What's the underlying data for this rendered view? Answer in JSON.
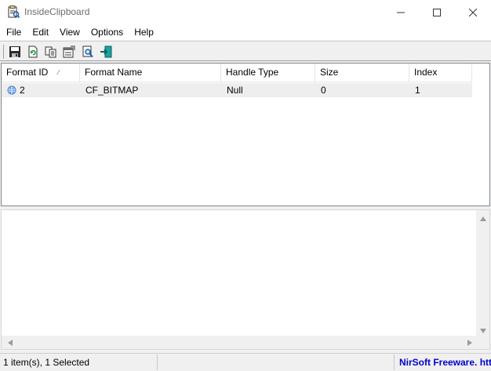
{
  "window": {
    "title": "InsideClipboard"
  },
  "menu": [
    "File",
    "Edit",
    "View",
    "Options",
    "Help"
  ],
  "toolbar": [
    {
      "name": "save-icon"
    },
    {
      "name": "refresh-icon"
    },
    {
      "name": "copy-icon"
    },
    {
      "name": "properties-icon"
    },
    {
      "name": "find-icon"
    },
    {
      "name": "exit-icon"
    }
  ],
  "table": {
    "columns": [
      "Format ID",
      "Format Name",
      "Handle Type",
      "Size",
      "Index"
    ],
    "sort_indicator": "∕",
    "rows": [
      {
        "format_id": "2",
        "format_name": "CF_BITMAP",
        "handle_type": "Null",
        "size": "0",
        "index": "1"
      }
    ]
  },
  "status": {
    "items": "1 item(s), 1 Selected",
    "link": "NirSoft Freeware.  htt"
  },
  "colors": {
    "link": "#0000cc",
    "selected_row": "#eeeeee",
    "row_icon": "#3a7bd5"
  }
}
